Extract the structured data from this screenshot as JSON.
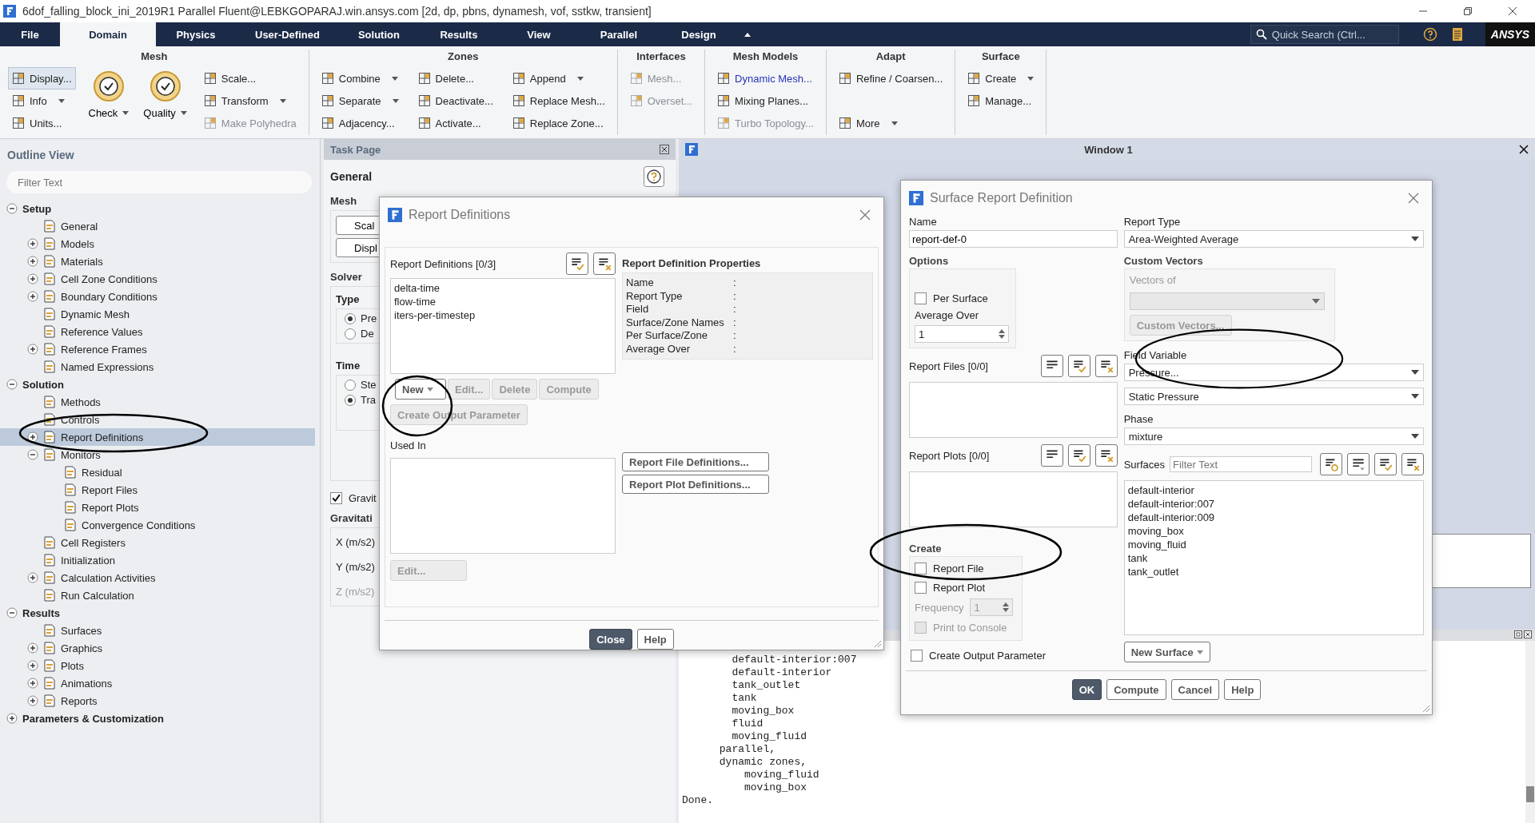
{
  "window": {
    "title": "6dof_falling_block_ini_2019R1 Parallel Fluent@LEBKGOPARAJ.win.ansys.com  [2d, dp, pbns, dynamesh, vof, sstkw, transient]"
  },
  "menu_tabs": [
    {
      "label": "File",
      "selected": false
    },
    {
      "label": "Domain",
      "selected": true
    },
    {
      "label": "Physics",
      "selected": false
    },
    {
      "label": "User-Defined",
      "selected": false
    },
    {
      "label": "Solution",
      "selected": false
    },
    {
      "label": "Results",
      "selected": false
    },
    {
      "label": "View",
      "selected": false
    },
    {
      "label": "Parallel",
      "selected": false
    },
    {
      "label": "Design",
      "selected": false
    }
  ],
  "quick_search": {
    "placeholder": "Quick Search (Ctrl..."
  },
  "brand": "ANSYS",
  "ribbon": [
    {
      "title": "Mesh",
      "columns": [
        [
          {
            "label": "Display...",
            "disabled": false,
            "pressed": true
          },
          {
            "label": "Info",
            "disabled": false,
            "dropdown": true
          },
          {
            "label": "Units...",
            "disabled": false
          }
        ],
        [
          {
            "label": "Check",
            "disabled": false,
            "dropdown": true,
            "kind": "large"
          }
        ],
        [
          {
            "label": "Quality",
            "disabled": false,
            "dropdown": true,
            "kind": "large"
          }
        ],
        [
          {
            "label": "Scale...",
            "disabled": false
          },
          {
            "label": "Transform",
            "disabled": false,
            "dropdown": true
          },
          {
            "label": "Make Polyhedra",
            "disabled": true
          }
        ]
      ]
    },
    {
      "title": "Zones",
      "columns": [
        [
          {
            "label": "Combine",
            "disabled": false,
            "dropdown": true
          },
          {
            "label": "Separate",
            "disabled": false,
            "dropdown": true
          },
          {
            "label": "Adjacency...",
            "disabled": false
          }
        ],
        [
          {
            "label": "Delete...",
            "disabled": false
          },
          {
            "label": "Deactivate...",
            "disabled": false
          },
          {
            "label": "Activate...",
            "disabled": false
          }
        ],
        [
          {
            "label": "Append",
            "disabled": false,
            "dropdown": true
          },
          {
            "label": "Replace Mesh...",
            "disabled": false
          },
          {
            "label": "Replace Zone...",
            "disabled": false
          }
        ]
      ]
    },
    {
      "title": "Interfaces",
      "columns": [
        [
          {
            "label": "Mesh...",
            "disabled": true
          },
          {
            "label": "Overset...",
            "disabled": true
          }
        ]
      ]
    },
    {
      "title": "Mesh Models",
      "columns": [
        [
          {
            "label": "Dynamic Mesh...",
            "disabled": false,
            "highlighted": true
          },
          {
            "label": "Mixing Planes...",
            "disabled": false
          },
          {
            "label": "Turbo Topology...",
            "disabled": true
          }
        ]
      ]
    },
    {
      "title": "Adapt",
      "columns": [
        [
          {
            "label": "Refine / Coarsen...",
            "disabled": false
          },
          {
            "label": "More",
            "disabled": false,
            "dropdown": true,
            "kind": "spaced"
          }
        ]
      ]
    },
    {
      "title": "Surface",
      "columns": [
        [
          {
            "label": "Create",
            "disabled": false,
            "dropdown": true
          },
          {
            "label": "Manage...",
            "disabled": false
          }
        ]
      ]
    }
  ],
  "outline": {
    "title": "Outline View",
    "filter_placeholder": "Filter Text",
    "tree": [
      {
        "label": "Setup",
        "expanded": true,
        "selected": false,
        "children": [
          {
            "label": "General",
            "selected": false
          },
          {
            "label": "Models",
            "expanded": false,
            "selected": false
          },
          {
            "label": "Materials",
            "expanded": false,
            "selected": false
          },
          {
            "label": "Cell Zone Conditions",
            "expanded": false,
            "selected": false
          },
          {
            "label": "Boundary Conditions",
            "expanded": false,
            "selected": false
          },
          {
            "label": "Dynamic Mesh",
            "selected": false
          },
          {
            "label": "Reference Values",
            "selected": false
          },
          {
            "label": "Reference Frames",
            "expanded": false,
            "selected": false
          },
          {
            "label": "Named Expressions",
            "selected": false
          }
        ]
      },
      {
        "label": "Solution",
        "expanded": true,
        "selected": false,
        "children": [
          {
            "label": "Methods",
            "selected": false
          },
          {
            "label": "Controls",
            "selected": false
          },
          {
            "label": "Report Definitions",
            "expanded": false,
            "selected": true
          },
          {
            "label": "Monitors",
            "expanded": true,
            "selected": false,
            "children": [
              {
                "label": "Residual",
                "selected": false
              },
              {
                "label": "Report Files",
                "selected": false
              },
              {
                "label": "Report Plots",
                "selected": false
              },
              {
                "label": "Convergence Conditions",
                "selected": false
              }
            ]
          },
          {
            "label": "Cell Registers",
            "selected": false
          },
          {
            "label": "Initialization",
            "selected": false
          },
          {
            "label": "Calculation Activities",
            "expanded": false,
            "selected": false
          },
          {
            "label": "Run Calculation",
            "selected": false
          }
        ]
      },
      {
        "label": "Results",
        "expanded": true,
        "selected": false,
        "children": [
          {
            "label": "Surfaces",
            "selected": false
          },
          {
            "label": "Graphics",
            "expanded": false,
            "selected": false
          },
          {
            "label": "Plots",
            "expanded": false,
            "selected": false
          },
          {
            "label": "Animations",
            "expanded": false,
            "selected": false
          },
          {
            "label": "Reports",
            "expanded": false,
            "selected": false
          }
        ]
      },
      {
        "label": "Parameters & Customization",
        "expanded": false,
        "selected": false
      }
    ]
  },
  "task_page": {
    "title": "Task Page",
    "heading": "General",
    "mesh_label": "Mesh",
    "mesh_buttons": [
      "Scal",
      "Displ"
    ],
    "solver_label": "Solver",
    "type_label": "Type",
    "type_options": [
      {
        "label": "Pre",
        "selected": true
      },
      {
        "label": "De",
        "selected": false
      }
    ],
    "time_label": "Time",
    "time_options": [
      {
        "label": "Ste",
        "selected": false
      },
      {
        "label": "Tra",
        "selected": true
      }
    ],
    "gravity": {
      "label": "Gravit",
      "checked": true
    },
    "gravity_heading": "Gravitati",
    "gravity_fields": [
      {
        "label": "X (m/s2)",
        "disabled": false
      },
      {
        "label": "Y (m/s2)",
        "disabled": false
      },
      {
        "label": "Z (m/s2)",
        "disabled": true
      }
    ]
  },
  "graphics_window": {
    "title": "Window 1"
  },
  "console": {
    "lines": [
      "        default-interior:007",
      "        default-interior",
      "        tank_outlet",
      "        tank",
      "        moving_box",
      "        fluid",
      "        moving_fluid",
      "      parallel,",
      "      dynamic zones,",
      "          moving_fluid",
      "          moving_box",
      "Done."
    ]
  },
  "report_definitions_dialog": {
    "title": "Report Definitions",
    "list_label": "Report Definitions  [0/3]",
    "items": [
      {
        "label": "delta-time",
        "selected": false
      },
      {
        "label": "flow-time",
        "selected": false
      },
      {
        "label": "iters-per-timestep",
        "selected": false
      }
    ],
    "actions": [
      {
        "label": "New",
        "disabled": false,
        "dropdown": true
      },
      {
        "label": "Edit...",
        "disabled": true
      },
      {
        "label": "Delete",
        "disabled": true
      },
      {
        "label": "Compute",
        "disabled": true
      }
    ],
    "create_output_parameter": {
      "label": "Create Output Parameter",
      "disabled": true
    },
    "used_in_label": "Used In",
    "used_in_edit": {
      "label": "Edit...",
      "disabled": true
    },
    "properties_title": "Report Definition Properties",
    "properties": [
      {
        "name": "Name",
        "separator": ":"
      },
      {
        "name": "Report Type",
        "separator": ":"
      },
      {
        "name": "Field",
        "separator": ":"
      },
      {
        "name": "Surface/Zone Names",
        "separator": ":"
      },
      {
        "name": "Per Surface/Zone",
        "separator": ":"
      },
      {
        "name": "Average Over",
        "separator": ":"
      }
    ],
    "definition_buttons": [
      "Report File Definitions...",
      "Report Plot Definitions..."
    ],
    "footer_buttons": [
      {
        "label": "Close",
        "kind": "primary"
      },
      {
        "label": "Help",
        "kind": "secondary"
      }
    ]
  },
  "surface_dialog": {
    "title": "Surface Report Definition",
    "name": {
      "label": "Name",
      "value": "report-def-0"
    },
    "report_type": {
      "label": "Report Type",
      "value": "Area-Weighted Average"
    },
    "options": {
      "title": "Options",
      "per_surface": {
        "label": "Per Surface",
        "checked": false
      },
      "average_over": {
        "label": "Average Over",
        "value": "1"
      }
    },
    "custom_vectors": {
      "title": "Custom Vectors",
      "vectors_of_label": "Vectors of",
      "button": "Custom Vectors..."
    },
    "field_variable": {
      "label": "Field Variable",
      "category": "Pressure...",
      "value": "Static Pressure"
    },
    "phase": {
      "label": "Phase",
      "value": "mixture"
    },
    "report_files": {
      "label": "Report Files  [0/0]"
    },
    "report_plots": {
      "label": "Report Plots  [0/0]"
    },
    "surfaces": {
      "label": "Surfaces",
      "filter_placeholder": "Filter Text",
      "items": [
        {
          "label": "default-interior",
          "selected": false
        },
        {
          "label": "default-interior:007",
          "selected": false
        },
        {
          "label": "default-interior:009",
          "selected": false
        },
        {
          "label": "moving_box",
          "selected": false
        },
        {
          "label": "moving_fluid",
          "selected": false
        },
        {
          "label": "tank",
          "selected": false
        },
        {
          "label": "tank_outlet",
          "selected": false
        }
      ]
    },
    "create": {
      "title": "Create",
      "report_file": {
        "label": "Report File",
        "checked": false
      },
      "report_plot": {
        "label": "Report Plot",
        "checked": false
      },
      "frequency": {
        "label": "Frequency",
        "value": "1",
        "disabled": true
      },
      "print_to_console": {
        "label": "Print to Console",
        "checked": false,
        "disabled": true
      }
    },
    "create_output_parameter": {
      "label": "Create Output Parameter",
      "checked": false
    },
    "new_surface_button": "New Surface",
    "footer_buttons": [
      {
        "label": "OK",
        "kind": "primary"
      },
      {
        "label": "Compute",
        "kind": "secondary"
      },
      {
        "label": "Cancel",
        "kind": "secondary"
      },
      {
        "label": "Help",
        "kind": "secondary"
      }
    ]
  }
}
